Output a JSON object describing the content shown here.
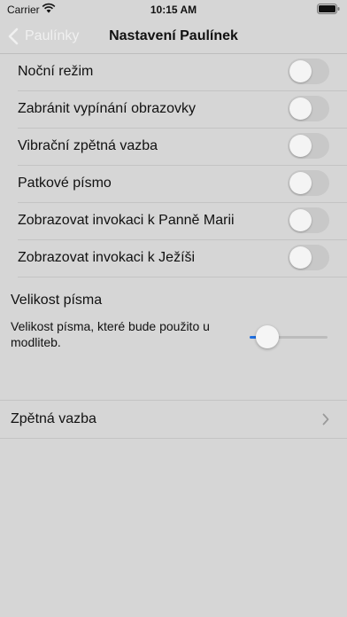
{
  "status_bar": {
    "carrier": "Carrier",
    "time": "10:15 AM",
    "wifi_icon": "wifi-icon",
    "battery_icon": "battery-icon"
  },
  "nav": {
    "back_label": "Paulínky",
    "back_icon": "chevron-left-icon",
    "title": "Nastavení Paulínek"
  },
  "settings": [
    {
      "label": "Noční režim",
      "enabled": false
    },
    {
      "label": "Zabránit vypínání obrazovky",
      "enabled": false
    },
    {
      "label": "Vibrační zpětná vazba",
      "enabled": false
    },
    {
      "label": "Patkové písmo",
      "enabled": false
    },
    {
      "label": "Zobrazovat invokaci k Panně Marii",
      "enabled": false
    },
    {
      "label": "Zobrazovat invokaci k Ježíši",
      "enabled": false
    }
  ],
  "font_size": {
    "heading": "Velikost písma",
    "description": "Velikost písma, které bude použito u modliteb.",
    "slider_value": 0.1
  },
  "feedback": {
    "label": "Zpětná vazba",
    "icon": "chevron-right-icon"
  },
  "colors": {
    "background": "#d6d6d6",
    "slider_accent": "#1f6fe0",
    "toggle_off": "#c8c8c8"
  }
}
